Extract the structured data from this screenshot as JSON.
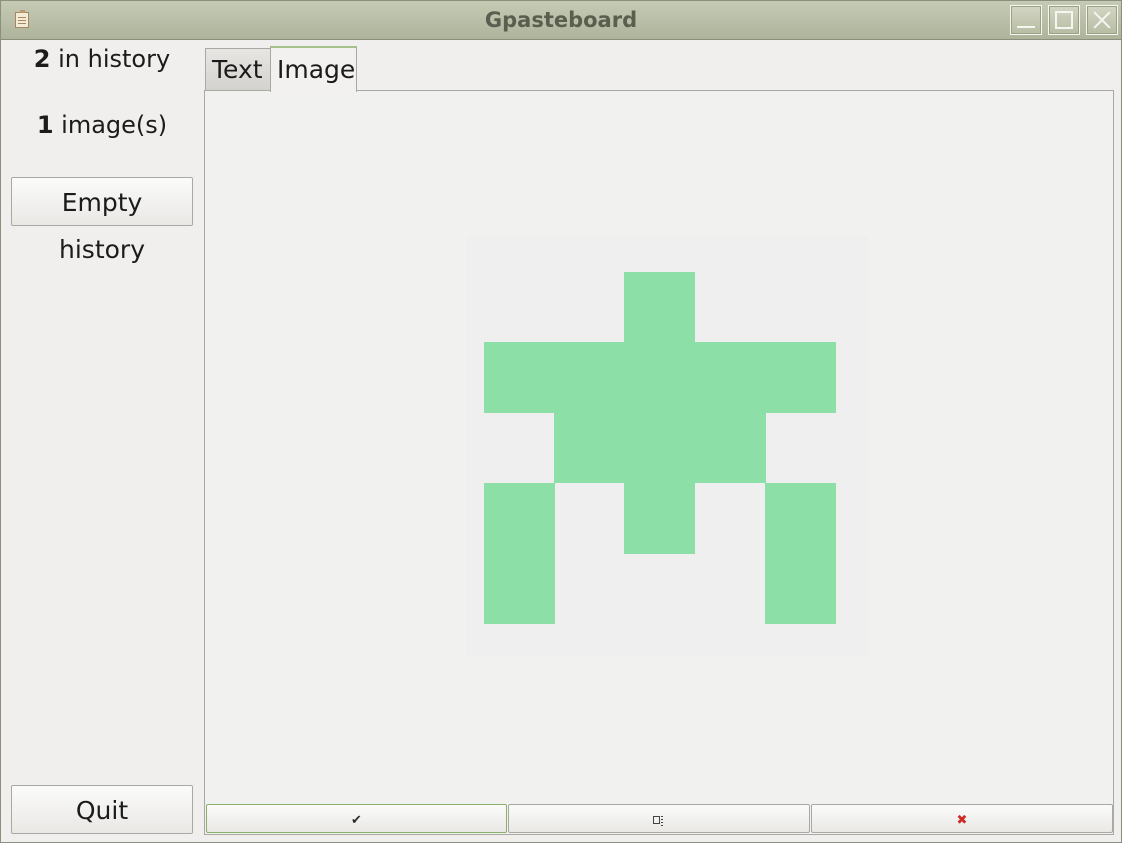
{
  "window": {
    "title": "Gpasteboard"
  },
  "sidebar": {
    "history_count": "2",
    "history_label": " in history",
    "image_count": "1",
    "image_label": " image(s)",
    "empty_button": "Empty history",
    "quit_button": "Quit"
  },
  "tabs": [
    {
      "label": "Text",
      "active": false
    },
    {
      "label": "Image",
      "active": true
    }
  ],
  "preview": {
    "image_color": "#8ddfa8",
    "pattern": [
      "..X..",
      "XXXXX",
      ".XXX.",
      "X.X.X",
      "X...X"
    ]
  },
  "actions": {
    "use_icon": "check-icon",
    "use_glyph": "✔",
    "save_icon": "save-to-file-icon",
    "delete_icon": "delete-icon",
    "delete_glyph": "✖"
  }
}
